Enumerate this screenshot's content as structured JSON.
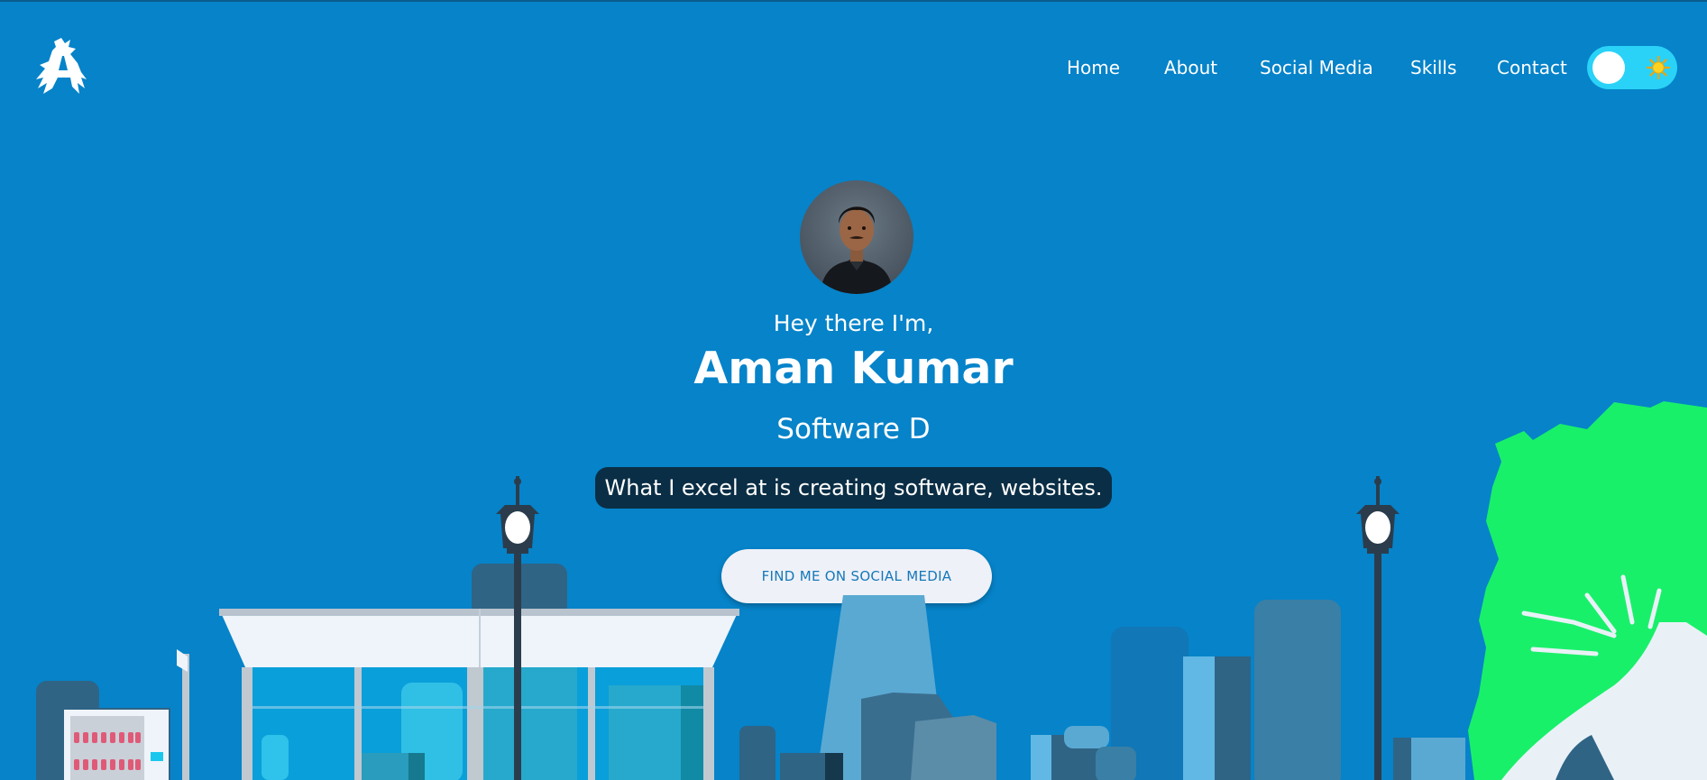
{
  "nav": {
    "items": [
      {
        "label": "Home"
      },
      {
        "label": "About"
      },
      {
        "label": "Social Media"
      },
      {
        "label": "Skills"
      },
      {
        "label": "Contact"
      }
    ]
  },
  "hero": {
    "greeting": "Hey there I'm,",
    "name": "Aman Kumar",
    "role": "Software D",
    "tagline": "What I excel at is creating software, websites.",
    "cta_label": "FIND ME ON SOCIAL MEDIA"
  },
  "icons": {
    "logo": "logo-icon",
    "theme_toggle": "sun-icon"
  },
  "colors": {
    "background": "#0683c9",
    "toggle": "#2ad2f7",
    "tagline_bg": "#0a2e45",
    "tree": "#19f06a",
    "cta_text": "#1678b8"
  }
}
